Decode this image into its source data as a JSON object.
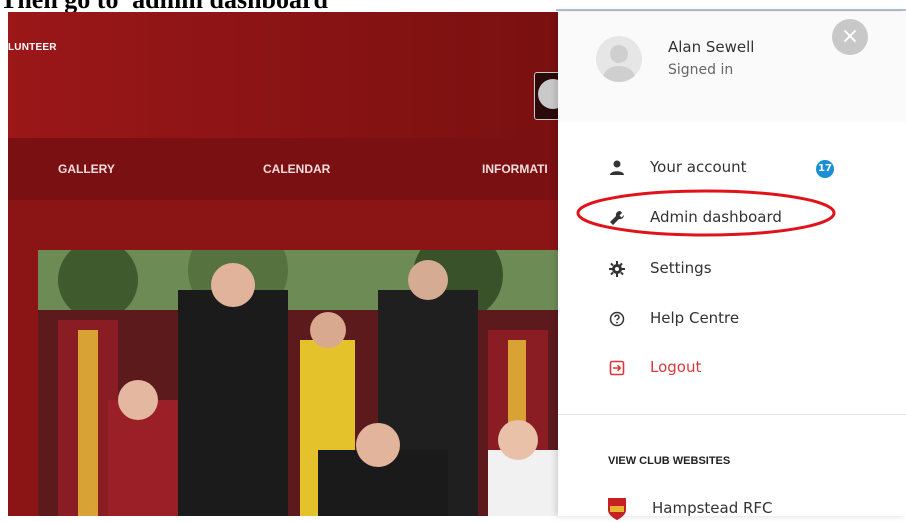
{
  "caption": "Then go to 'admin dashboard'",
  "site": {
    "logo_text": "LUNTEER",
    "nav": [
      "GALLERY",
      "CALENDAR",
      "INFORMATI"
    ]
  },
  "panel": {
    "user_name": "Alan Sewell",
    "user_status": "Signed in",
    "menu": [
      {
        "label": "Your account",
        "icon": "person-icon",
        "badge": "17"
      },
      {
        "label": "Admin dashboard",
        "icon": "wrench-icon"
      },
      {
        "label": "Settings",
        "icon": "gear-icon"
      },
      {
        "label": "Help Centre",
        "icon": "help-icon"
      },
      {
        "label": "Logout",
        "icon": "logout-icon"
      }
    ],
    "section_title": "VIEW CLUB WEBSITES",
    "clubs": [
      {
        "label": "Hampstead RFC",
        "icon": "club-crest-icon"
      }
    ]
  },
  "colors": {
    "site_red": "#8b1415",
    "badge_blue": "#1a8fd6",
    "logout_red": "#d9393a",
    "annotation_red": "#e0121a"
  }
}
